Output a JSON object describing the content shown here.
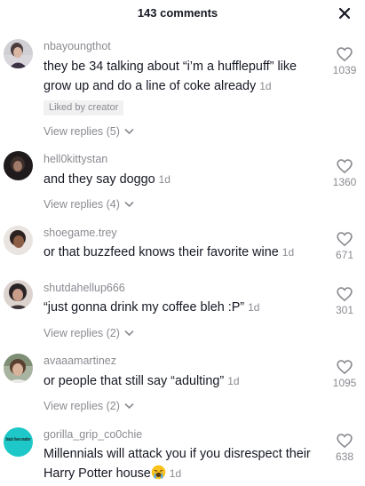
{
  "header": {
    "title": "143 comments",
    "close_icon": "close-icon"
  },
  "comments": [
    {
      "username": "nbayoungthot",
      "text": "they be 34 talking about “i’m a hufflepuff” like grow up and do a line of coke already",
      "time": "1d",
      "badge": "Liked by creator",
      "replies": "View replies (5)",
      "likes": "1039"
    },
    {
      "username": "hell0kittystan",
      "text": "and they say doggo",
      "time": "1d",
      "replies": "View replies (4)",
      "likes": "1360"
    },
    {
      "username": "shoegame.trey",
      "text": "or that buzzfeed knows their favorite wine",
      "time": "1d",
      "likes": "671"
    },
    {
      "username": "shutdahellup666",
      "text": "“just gonna drink my coffee bleh :P”",
      "time": "1d",
      "replies": "View replies (2)",
      "likes": "301"
    },
    {
      "username": "avaaamartinez",
      "text": "or people that still say “adulting”",
      "time": "1d",
      "replies": "View replies (2)",
      "likes": "1095"
    },
    {
      "username": "gorilla_grip_co0chie",
      "avatar_text": "black lives matter",
      "text": "Millennials will attack you if you disrespect their Harry Potter house",
      "emoji": "loudly-crying-face-emoji",
      "time": "1d",
      "likes": "638"
    }
  ]
}
